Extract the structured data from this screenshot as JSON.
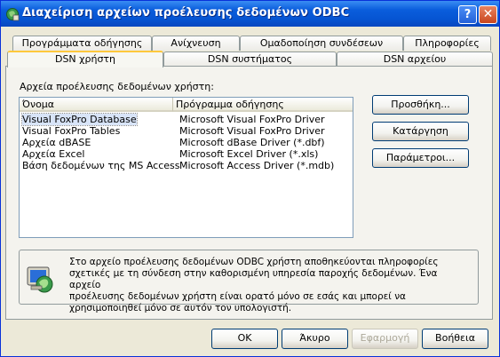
{
  "window": {
    "title": "Διαχείριση αρχείων προέλευσης δεδομένων ODBC",
    "help_glyph": "?",
    "close_glyph": "✕"
  },
  "tabs": {
    "row1": [
      "Προγράμματα οδήγησης",
      "Ανίχνευση",
      "Ομαδοποίηση συνδέσεων",
      "Πληροφορίες"
    ],
    "row2": [
      "DSN χρήστη",
      "DSN συστήματος",
      "DSN αρχείου"
    ],
    "active": "DSN χρήστη"
  },
  "list": {
    "label": "Αρχεία προέλευσης δεδομένων χρήστη:",
    "columns": [
      "Όνομα",
      "Πρόγραμμα οδήγησης"
    ],
    "rows": [
      {
        "name": "Visual FoxPro Database",
        "driver": "Microsoft Visual FoxPro Driver",
        "selected": true
      },
      {
        "name": "Visual FoxPro Tables",
        "driver": "Microsoft Visual FoxPro Driver",
        "selected": false
      },
      {
        "name": "Αρχεία dBASE",
        "driver": "Microsoft dBase Driver (*.dbf)",
        "selected": false
      },
      {
        "name": "Αρχεία Excel",
        "driver": "Microsoft Excel Driver (*.xls)",
        "selected": false
      },
      {
        "name": "Βάση δεδομένων της MS Access",
        "driver": "Microsoft Access Driver (*.mdb)",
        "selected": false
      }
    ]
  },
  "side_buttons": {
    "add": "Προσθήκη...",
    "remove": "Κατάργηση",
    "configure": "Παράμετροι..."
  },
  "info": {
    "lines": [
      "Στο αρχείο προέλευσης δεδομένων ODBC χρήστη αποθηκεύονται πληροφορίες",
      "σχετικές με τη σύνδεση στην καθορισμένη υπηρεσία παροχής δεδομένων. Ένα αρχείο",
      "προέλευσης δεδομένων χρήστη είναι ορατό μόνο σε εσάς και μπορεί να",
      "χρησιμοποιηθεί μόνο σε αυτόν τον υπολογιστή."
    ]
  },
  "footer": {
    "ok": "OK",
    "cancel": "Άκυρο",
    "apply": "Εφαρμογή",
    "help": "Βοήθεια"
  }
}
